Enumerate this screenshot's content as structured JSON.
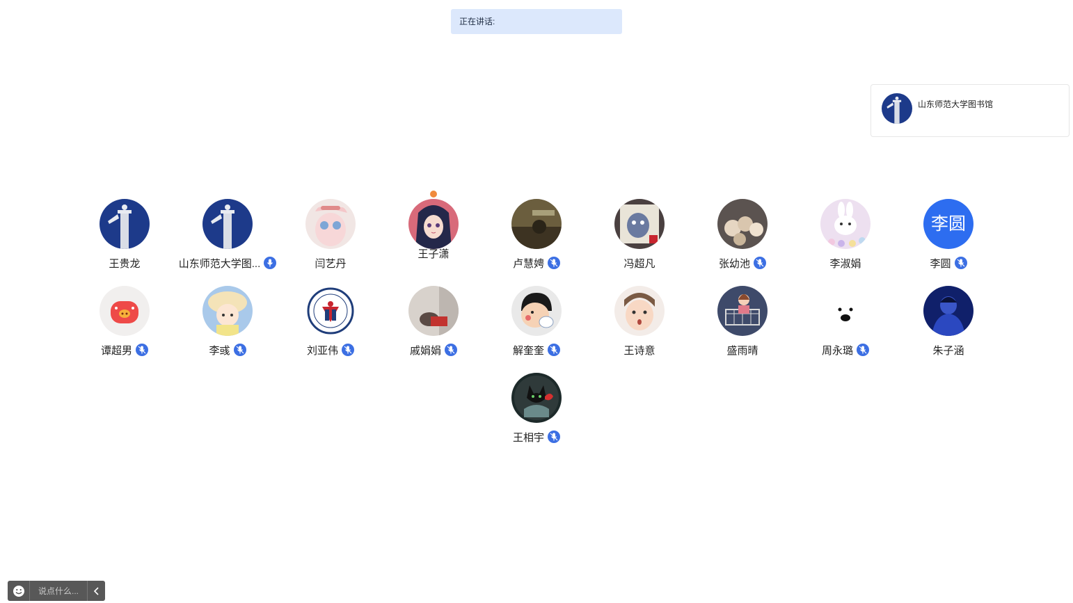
{
  "header": {
    "speaking_label": "正在讲话:"
  },
  "presenter": {
    "name": "山东师范大学图书馆",
    "avatar": "monument-avatar"
  },
  "members": [
    {
      "name": "王贵龙",
      "avatar": "monument-avatar",
      "mic": false
    },
    {
      "name": "山东师范大学图...",
      "avatar": "monument-avatar",
      "mic": true,
      "mic_active": true
    },
    {
      "name": "闫艺丹",
      "avatar": "pink-toy-avatar",
      "mic": false
    },
    {
      "name": "王子潇",
      "avatar": "anime-girl-avatar",
      "mic": false,
      "badge": "host-badge"
    },
    {
      "name": "卢慧娉",
      "avatar": "text-photo-avatar",
      "mic": true
    },
    {
      "name": "冯超凡",
      "avatar": "cartoon-cat-avatar",
      "mic": false,
      "badge": "heart-badge"
    },
    {
      "name": "张幼池",
      "avatar": "plush-toys-avatar",
      "mic": true
    },
    {
      "name": "李淑娟",
      "avatar": "bunny-avatar",
      "mic": false
    },
    {
      "name": "李圆",
      "avatar_text": "李圆",
      "mic": true
    },
    {
      "name": "谭超男",
      "avatar": "pig-avatar",
      "mic": true
    },
    {
      "name": "李彧",
      "avatar": "girl-hat-avatar",
      "mic": true
    },
    {
      "name": "刘亚伟",
      "avatar": "university-logo-avatar",
      "mic": true
    },
    {
      "name": "戚娟娟",
      "avatar": "photo-avatar",
      "mic": true
    },
    {
      "name": "解奎奎",
      "avatar": "cartoon-boy-avatar",
      "mic": true
    },
    {
      "name": "王诗意",
      "avatar": "baby-avatar",
      "mic": false
    },
    {
      "name": "盛雨晴",
      "avatar": "cart-girl-avatar",
      "mic": false
    },
    {
      "name": "周永璐",
      "avatar": "white-bear-avatar",
      "mic": true
    },
    {
      "name": "朱子涵",
      "avatar": "blue-illustration-avatar",
      "mic": false
    },
    {
      "name": "王相宇",
      "avatar": "black-cat-avatar",
      "mic": true
    }
  ],
  "chat": {
    "placeholder": "说点什么..."
  },
  "colors": {
    "accent": "#3c6fe3",
    "speaking_bg": "#dce8fc",
    "text_avatar_bg": "#2d6df0"
  }
}
